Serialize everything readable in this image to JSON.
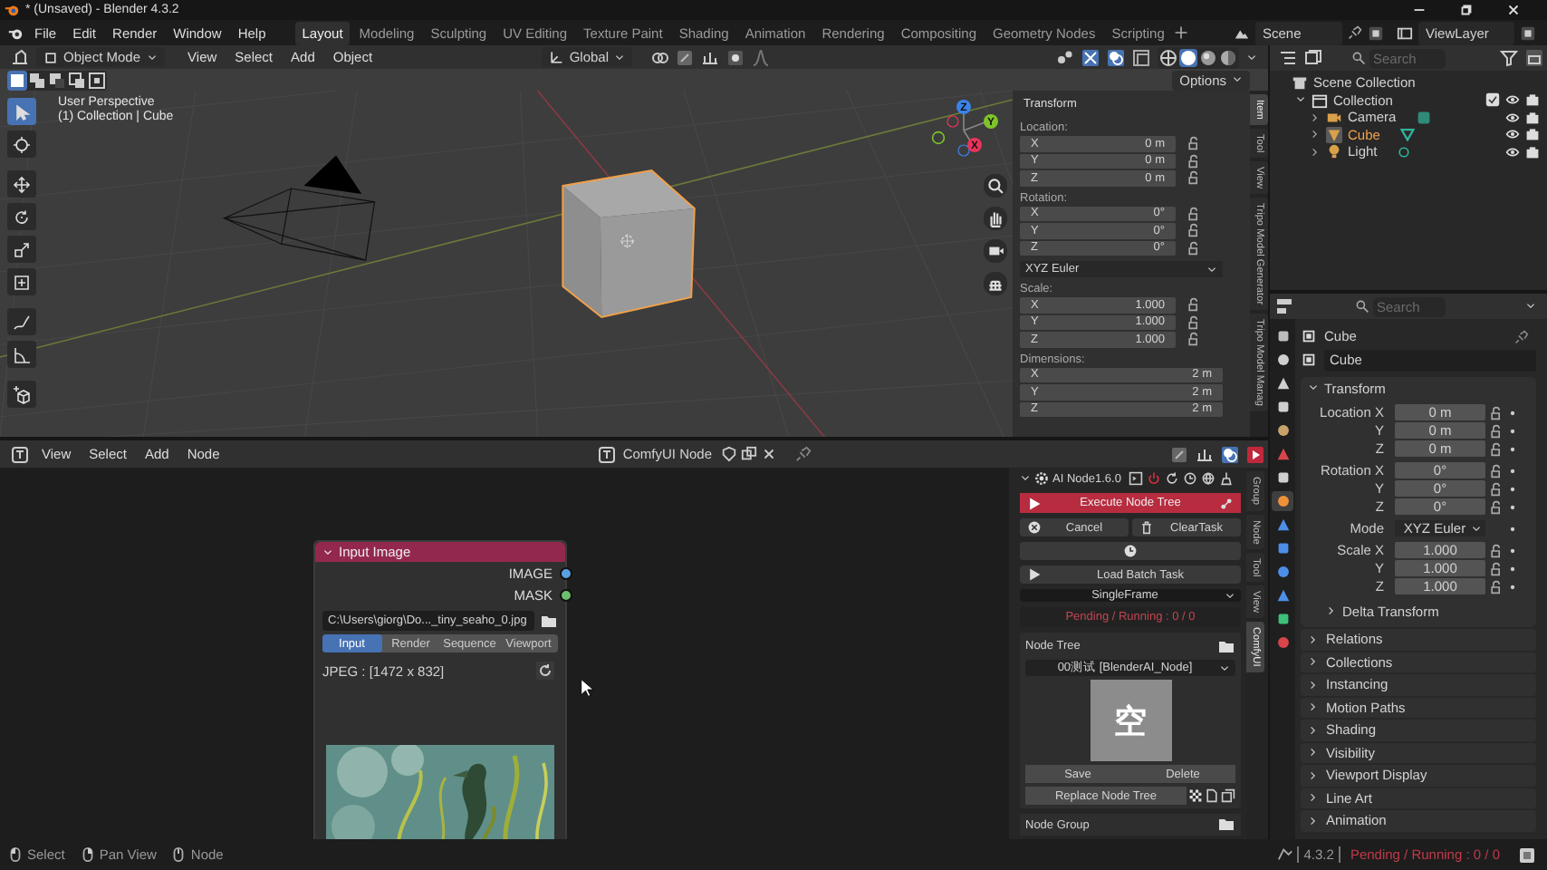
{
  "window": {
    "title": "* (Unsaved) - Blender 4.3.2"
  },
  "menu": [
    "File",
    "Edit",
    "Render",
    "Window",
    "Help"
  ],
  "workspaces": [
    {
      "label": "Layout",
      "selected": true
    },
    {
      "label": "Modeling",
      "selected": false
    },
    {
      "label": "Sculpting",
      "selected": false
    },
    {
      "label": "UV Editing",
      "selected": false
    },
    {
      "label": "Texture Paint",
      "selected": false
    },
    {
      "label": "Shading",
      "selected": false
    },
    {
      "label": "Animation",
      "selected": false
    },
    {
      "label": "Rendering",
      "selected": false
    },
    {
      "label": "Compositing",
      "selected": false
    },
    {
      "label": "Geometry Nodes",
      "selected": false
    },
    {
      "label": "Scripting",
      "selected": false
    }
  ],
  "scene": "Scene",
  "view_layer": "ViewLayer",
  "viewport": {
    "mode": "Object Mode",
    "menus": [
      "View",
      "Select",
      "Add",
      "Object"
    ],
    "orientation": "Global",
    "options": "Options",
    "info": [
      "User Perspective",
      "(1) Collection | Cube"
    ],
    "axes": [
      {
        "label": "Z",
        "color": "#3c82e6"
      },
      {
        "label": "Y",
        "color": "#7ec42a"
      },
      {
        "label": "X",
        "color": "#e8345a"
      }
    ],
    "tools": [
      {
        "kind": "select",
        "selected": true
      },
      {
        "kind": "cursor",
        "selected": false
      },
      {
        "kind": "move",
        "selected": false
      },
      {
        "kind": "rotate",
        "selected": false
      },
      {
        "kind": "scale",
        "selected": false
      },
      {
        "kind": "transform",
        "selected": false
      },
      {
        "kind": "annotate",
        "selected": false
      },
      {
        "kind": "measure",
        "selected": false
      },
      {
        "kind": "add-cube",
        "selected": false
      }
    ],
    "sidebar_tabs": [
      {
        "label": "Item",
        "selected": true
      },
      {
        "label": "Tool",
        "selected": false
      },
      {
        "label": "View",
        "selected": false
      },
      {
        "label": "Tripo Model Generator",
        "selected": false
      },
      {
        "label": "Tripo Model Manag",
        "selected": false
      }
    ],
    "transform": {
      "title": "Transform",
      "groups": [
        {
          "kind": "fields",
          "label": "Location:",
          "locks": true,
          "rows": [
            {
              "axis": "X",
              "value": "0 m"
            },
            {
              "axis": "Y",
              "value": "0 m"
            },
            {
              "axis": "Z",
              "value": "0 m"
            }
          ]
        },
        {
          "kind": "fields",
          "label": "Rotation:",
          "locks": true,
          "rows": [
            {
              "axis": "X",
              "value": "0°"
            },
            {
              "axis": "Y",
              "value": "0°"
            },
            {
              "axis": "Z",
              "value": "0°"
            }
          ]
        },
        {
          "kind": "dropdown",
          "value": "XYZ Euler"
        },
        {
          "kind": "fields",
          "label": "Scale:",
          "locks": true,
          "rows": [
            {
              "axis": "X",
              "value": "1.000"
            },
            {
              "axis": "Y",
              "value": "1.000"
            },
            {
              "axis": "Z",
              "value": "1.000"
            }
          ]
        },
        {
          "kind": "fields",
          "label": "Dimensions:",
          "locks": false,
          "rows": [
            {
              "axis": "X",
              "value": "2 m"
            },
            {
              "axis": "Y",
              "value": "2 m"
            },
            {
              "axis": "Z",
              "value": "2 m"
            }
          ]
        }
      ]
    }
  },
  "node_editor": {
    "menus": [
      "View",
      "Select",
      "Add",
      "Node"
    ],
    "tree": "ComfyUI Node",
    "node": {
      "title": "Input Image",
      "outputs": [
        {
          "label": "IMAGE",
          "color": "#5aa0e0"
        },
        {
          "label": "MASK",
          "color": "#6cbf6c"
        }
      ],
      "path": "C:\\Users\\giorg\\Do..._tiny_seaho_0.jpg",
      "sources": [
        {
          "label": "Input",
          "selected": true
        },
        {
          "label": "Render",
          "selected": false
        },
        {
          "label": "Sequence",
          "selected": false
        },
        {
          "label": "Viewport",
          "selected": false
        }
      ],
      "info": "JPEG : [1472 x 832]"
    },
    "sidebar_tabs": [
      {
        "label": "Group",
        "selected": false
      },
      {
        "label": "Node",
        "selected": false
      },
      {
        "label": "Tool",
        "selected": false
      },
      {
        "label": "View",
        "selected": false
      },
      {
        "label": "ComfyUI",
        "selected": true
      }
    ],
    "ai_panel": {
      "title": "AI Node1.6.0",
      "execute": "Execute Node Tree",
      "cancel": "Cancel",
      "clear": "ClearTask",
      "load": "Load Batch Task",
      "frame_mode": "SingleFrame",
      "status": "Pending / Running : 0 / 0",
      "node_tree": {
        "label": "Node Tree",
        "value": "00测试 [BlenderAI_Node]",
        "thumbnail": "空",
        "save": "Save",
        "delete": "Delete",
        "replace": "Replace Node Tree"
      },
      "node_group": "Node Group"
    }
  },
  "outliner": {
    "search": {
      "placeholder": "Search"
    },
    "root": "Scene Collection",
    "collections": [
      {
        "label": "Collection",
        "expanded": true,
        "checked": true,
        "children": [
          {
            "label": "Camera",
            "kind": "camera",
            "expanded": false,
            "active": false
          },
          {
            "label": "Cube",
            "kind": "mesh",
            "expanded": false,
            "active": true
          },
          {
            "label": "Light",
            "kind": "light",
            "expanded": false,
            "active": false
          }
        ]
      }
    ]
  },
  "properties": {
    "search": {
      "placeholder": "Search"
    },
    "tabs": [
      {
        "kind": "tool",
        "selected": false
      },
      {
        "kind": "render",
        "selected": false
      },
      {
        "kind": "output",
        "selected": false
      },
      {
        "kind": "view-layer",
        "selected": false
      },
      {
        "kind": "scene",
        "selected": false
      },
      {
        "kind": "world",
        "selected": false
      },
      {
        "kind": "collection",
        "selected": false
      },
      {
        "kind": "object",
        "selected": true
      },
      {
        "kind": "modifier",
        "selected": false
      },
      {
        "kind": "particles",
        "selected": false
      },
      {
        "kind": "physics",
        "selected": false
      },
      {
        "kind": "constraints",
        "selected": false
      },
      {
        "kind": "data",
        "selected": false
      },
      {
        "kind": "material",
        "selected": false
      }
    ],
    "object": "Cube",
    "name": "Cube",
    "transform": {
      "title": "Transform",
      "groups": [
        [
          {
            "kind": "field",
            "label": "Location X",
            "value": "0 m"
          },
          {
            "kind": "field",
            "label": "Y",
            "value": "0 m"
          },
          {
            "kind": "field",
            "label": "Z",
            "value": "0 m"
          }
        ],
        [
          {
            "kind": "field",
            "label": "Rotation X",
            "value": "0°"
          },
          {
            "kind": "field",
            "label": "Y",
            "value": "0°"
          },
          {
            "kind": "field",
            "label": "Z",
            "value": "0°"
          }
        ],
        [
          {
            "kind": "dropdown",
            "label": "Mode",
            "value": "XYZ Euler"
          }
        ],
        [
          {
            "kind": "field",
            "label": "Scale X",
            "value": "1.000"
          },
          {
            "kind": "field",
            "label": "Y",
            "value": "1.000"
          },
          {
            "kind": "field",
            "label": "Z",
            "value": "1.000"
          }
        ]
      ],
      "subpanel": "Delta Transform"
    },
    "panels": [
      "Relations",
      "Collections",
      "Instancing",
      "Motion Paths",
      "Shading",
      "Visibility",
      "Viewport Display",
      "Line Art",
      "Animation"
    ]
  },
  "status_bar": {
    "hints": [
      "Select",
      "Pan View",
      "Node"
    ],
    "version": "4.3.2",
    "status": "Pending / Running : 0 / 0"
  }
}
